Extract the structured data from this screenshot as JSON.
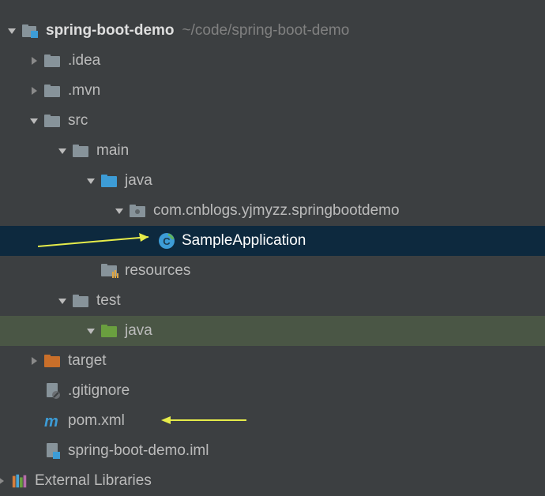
{
  "root": {
    "name": "spring-boot-demo",
    "path": "~/code/spring-boot-demo"
  },
  "nodes": {
    "idea": ".idea",
    "mvn": ".mvn",
    "src": "src",
    "main": "main",
    "java_main": "java",
    "package": "com.cnblogs.yjmyzz.springbootdemo",
    "sample": "SampleApplication",
    "resources": "resources",
    "test": "test",
    "java_test": "java",
    "target": "target",
    "gitignore": ".gitignore",
    "pom": "pom.xml",
    "iml": "spring-boot-demo.iml",
    "ext_libs": "External Libraries"
  },
  "colors": {
    "folder_grey": "#87939a",
    "folder_blue": "#3d9cd6",
    "folder_green": "#6a9f3f",
    "folder_orange": "#c99543",
    "maven_m": "#3d9cd6"
  }
}
